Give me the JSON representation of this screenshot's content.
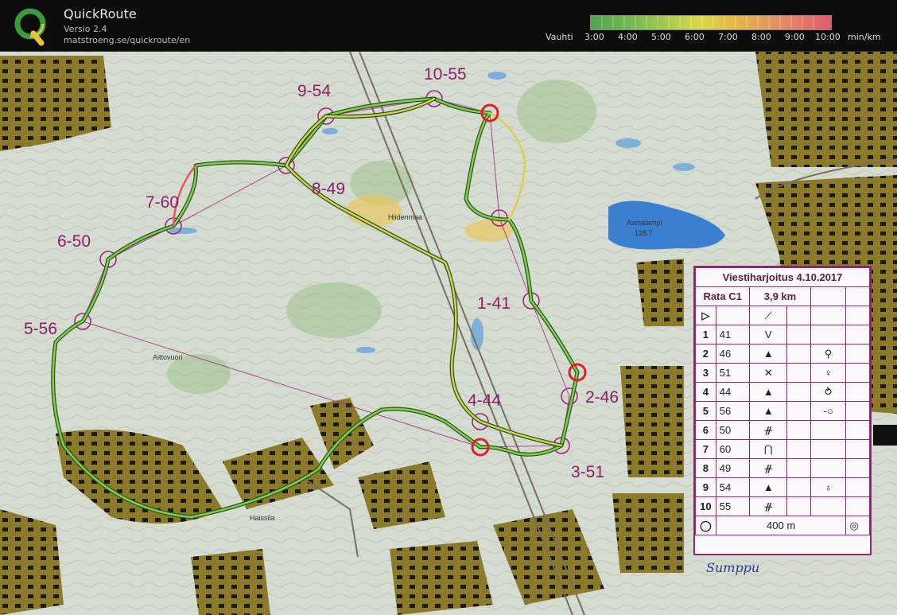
{
  "app": {
    "name": "QuickRoute",
    "version": "Versio 2.4",
    "url": "matstroeng.se/quickroute/en"
  },
  "legend": {
    "pace_label": "Vauhti",
    "ticks": [
      "3:00",
      "4:00",
      "5:00",
      "6:00",
      "7:00",
      "8:00",
      "9:00",
      "10:00"
    ],
    "unit": "min/km",
    "colors": {
      "slow": "#e25a6b",
      "medium": "#d8d94b",
      "fast": "#4fa24f"
    }
  },
  "map": {
    "place_names": [
      "Hiidenmaa",
      "Asmalampi",
      "128.7",
      "Aittovuori",
      "Haissila"
    ],
    "control_labels": [
      "10-55",
      "9-54",
      "8-49",
      "7-60",
      "6-50",
      "5-56",
      "1-41",
      "2-46",
      "4-44",
      "3-51"
    ],
    "signature": "Sumppu"
  },
  "control_sheet": {
    "title": "Viestiharjoitus 4.10.2017",
    "course": "Rata C1",
    "length": "3,9 km",
    "rows": [
      {
        "num": "1",
        "code": "41",
        "symbol": "V",
        "extra": ""
      },
      {
        "num": "2",
        "code": "46",
        "symbol": "▲",
        "extra": "⚲"
      },
      {
        "num": "3",
        "code": "51",
        "symbol": "✕",
        "extra": "♀"
      },
      {
        "num": "4",
        "code": "44",
        "symbol": "▲",
        "extra": "⥁"
      },
      {
        "num": "5",
        "code": "56",
        "symbol": "▲",
        "extra": "-○"
      },
      {
        "num": "6",
        "code": "50",
        "symbol": "ᚌ",
        "extra": ""
      },
      {
        "num": "7",
        "code": "60",
        "symbol": "⋂",
        "extra": ""
      },
      {
        "num": "8",
        "code": "49",
        "symbol": "ᚌ",
        "extra": ""
      },
      {
        "num": "9",
        "code": "54",
        "symbol": "▲",
        "extra": "♁"
      },
      {
        "num": "10",
        "code": "55",
        "symbol": "ᚌ",
        "extra": ""
      }
    ],
    "finish_distance": "400 m"
  }
}
